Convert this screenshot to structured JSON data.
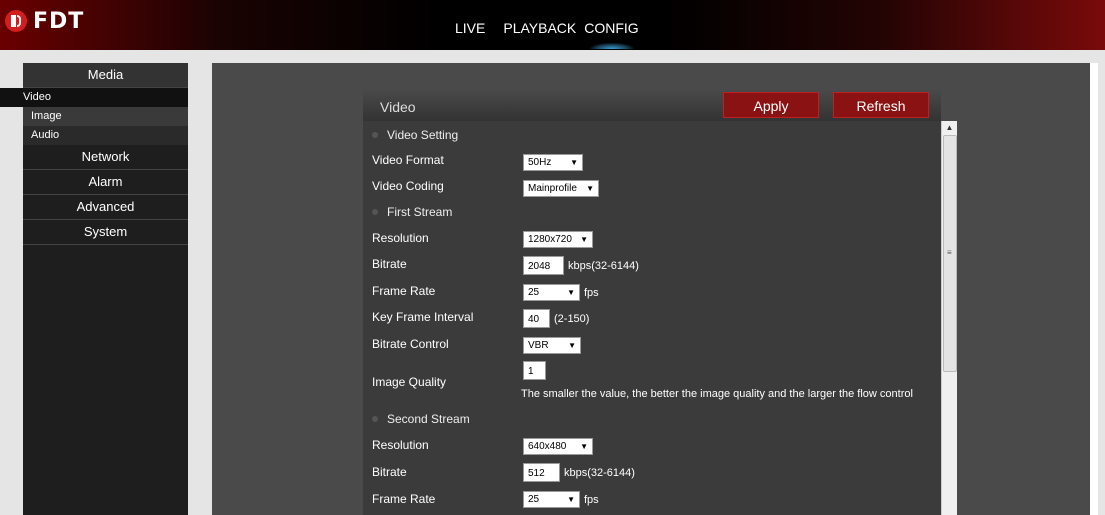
{
  "app": {
    "logo_text": "FDT",
    "nav": [
      {
        "label": "LIVE"
      },
      {
        "label": "PLAYBACK"
      },
      {
        "label": "CONFIG"
      }
    ]
  },
  "sidebar": {
    "media": "Media",
    "media_items": [
      "Video",
      "Image",
      "Audio"
    ],
    "items": [
      "Network",
      "Alarm",
      "Advanced",
      "System"
    ]
  },
  "panel": {
    "title": "Video",
    "apply_label": "Apply",
    "refresh_label": "Refresh"
  },
  "video_setting": {
    "section": "Video Setting",
    "format_label": "Video Format",
    "format_value": "50Hz",
    "coding_label": "Video Coding",
    "coding_value": "Mainprofile"
  },
  "first_stream": {
    "section": "First Stream",
    "resolution_label": "Resolution",
    "resolution_value": "1280x720",
    "bitrate_label": "Bitrate",
    "bitrate_value": "2048",
    "bitrate_range": "kbps(32-6144)",
    "framerate_label": "Frame Rate",
    "framerate_value": "25",
    "framerate_unit": "fps",
    "keyframe_label": "Key Frame Interval",
    "keyframe_value": "40",
    "keyframe_range": "(2-150)",
    "bitrate_control_label": "Bitrate Control",
    "bitrate_control_value": "VBR",
    "quality_label": "Image Quality",
    "quality_value": "1",
    "quality_hint": "The smaller the value, the better the image quality and the larger the flow control"
  },
  "second_stream": {
    "section": "Second Stream",
    "resolution_label": "Resolution",
    "resolution_value": "640x480",
    "bitrate_label": "Bitrate",
    "bitrate_value": "512",
    "bitrate_range": "kbps(32-6144)",
    "framerate_label": "Frame Rate",
    "framerate_value": "25",
    "framerate_unit": "fps"
  },
  "colors": {
    "accent": "#8b1212",
    "panel_bg": "#3b3b3b",
    "nav_indicator": "#3aa0d8"
  }
}
